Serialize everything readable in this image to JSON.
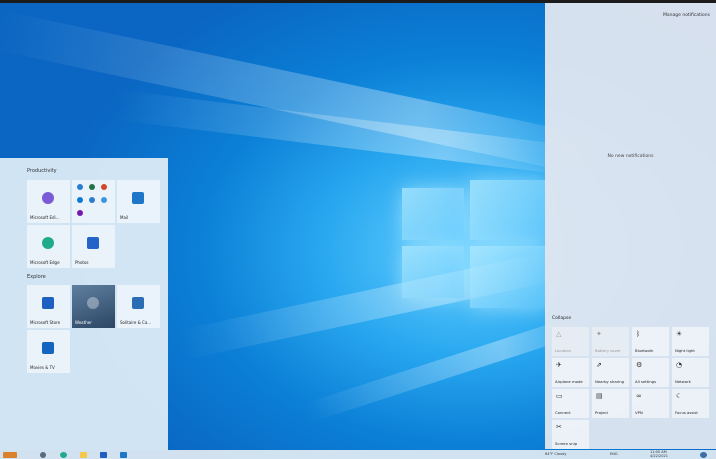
{
  "desktop": {
    "colors": {
      "wallpaper": "#0b7fd6",
      "glow": "#6ad0ff"
    }
  },
  "start_menu": {
    "groups": [
      {
        "title": "Productivity",
        "tiles": [
          {
            "label": "Microsoft Edi...",
            "icon": "office-icon",
            "color": "#7b5bd6"
          },
          {
            "label": "",
            "icon": "office-apps-folder-icon",
            "color": "#2b7cd3"
          },
          {
            "label": "Mail",
            "icon": "mail-icon",
            "color": "#1e76c8"
          },
          {
            "label": "Microsoft Edge",
            "icon": "edge-icon",
            "color": "#1faa8c"
          },
          {
            "label": "Photos",
            "icon": "photos-icon",
            "color": "#2563c9"
          }
        ]
      },
      {
        "title": "Explore",
        "tiles": [
          {
            "label": "Microsoft Store",
            "icon": "store-icon",
            "color": "#1f5fbf"
          },
          {
            "label": "Weather",
            "icon": "weather-icon",
            "color": "#3d5a7a"
          },
          {
            "label": "Solitaire & Ca...",
            "icon": "solitaire-icon",
            "color": "#2a6db5"
          },
          {
            "label": "Movies & TV",
            "icon": "movies-icon",
            "color": "#1565c0"
          }
        ]
      }
    ]
  },
  "action_center": {
    "manage_label": "Manage notifications",
    "empty_label": "No new notifications",
    "collapse_label": "Collapse",
    "quick_actions": [
      {
        "label": "Location",
        "icon": "△",
        "name": "location",
        "enabled": false
      },
      {
        "label": "Battery saver",
        "icon": "✦",
        "name": "battery-saver",
        "enabled": false
      },
      {
        "label": "Bluetooth",
        "icon": "ᛒ",
        "name": "bluetooth",
        "enabled": true
      },
      {
        "label": "Night light",
        "icon": "☀",
        "name": "night-light",
        "enabled": true
      },
      {
        "label": "Airplane mode",
        "icon": "✈",
        "name": "airplane-mode",
        "enabled": true
      },
      {
        "label": "Nearby sharing",
        "icon": "⇗",
        "name": "nearby-sharing",
        "enabled": true
      },
      {
        "label": "All settings",
        "icon": "⚙",
        "name": "all-settings",
        "enabled": true
      },
      {
        "label": "Network",
        "icon": "◔",
        "name": "network",
        "enabled": true
      },
      {
        "label": "Connect",
        "icon": "▭",
        "name": "connect",
        "enabled": true
      },
      {
        "label": "Project",
        "icon": "▤",
        "name": "project",
        "enabled": true
      },
      {
        "label": "VPN",
        "icon": "∞",
        "name": "vpn",
        "enabled": true
      },
      {
        "label": "Focus assist",
        "icon": "☾",
        "name": "focus-assist",
        "enabled": true
      },
      {
        "label": "Screen snip",
        "icon": "✂",
        "name": "screen-snip",
        "enabled": true
      }
    ]
  },
  "taskbar": {
    "search_placeholder": "",
    "weather_text": "64°F  Cloudy",
    "time": "11:00 AM",
    "date": "4/22/2021",
    "lang": "ENG"
  }
}
